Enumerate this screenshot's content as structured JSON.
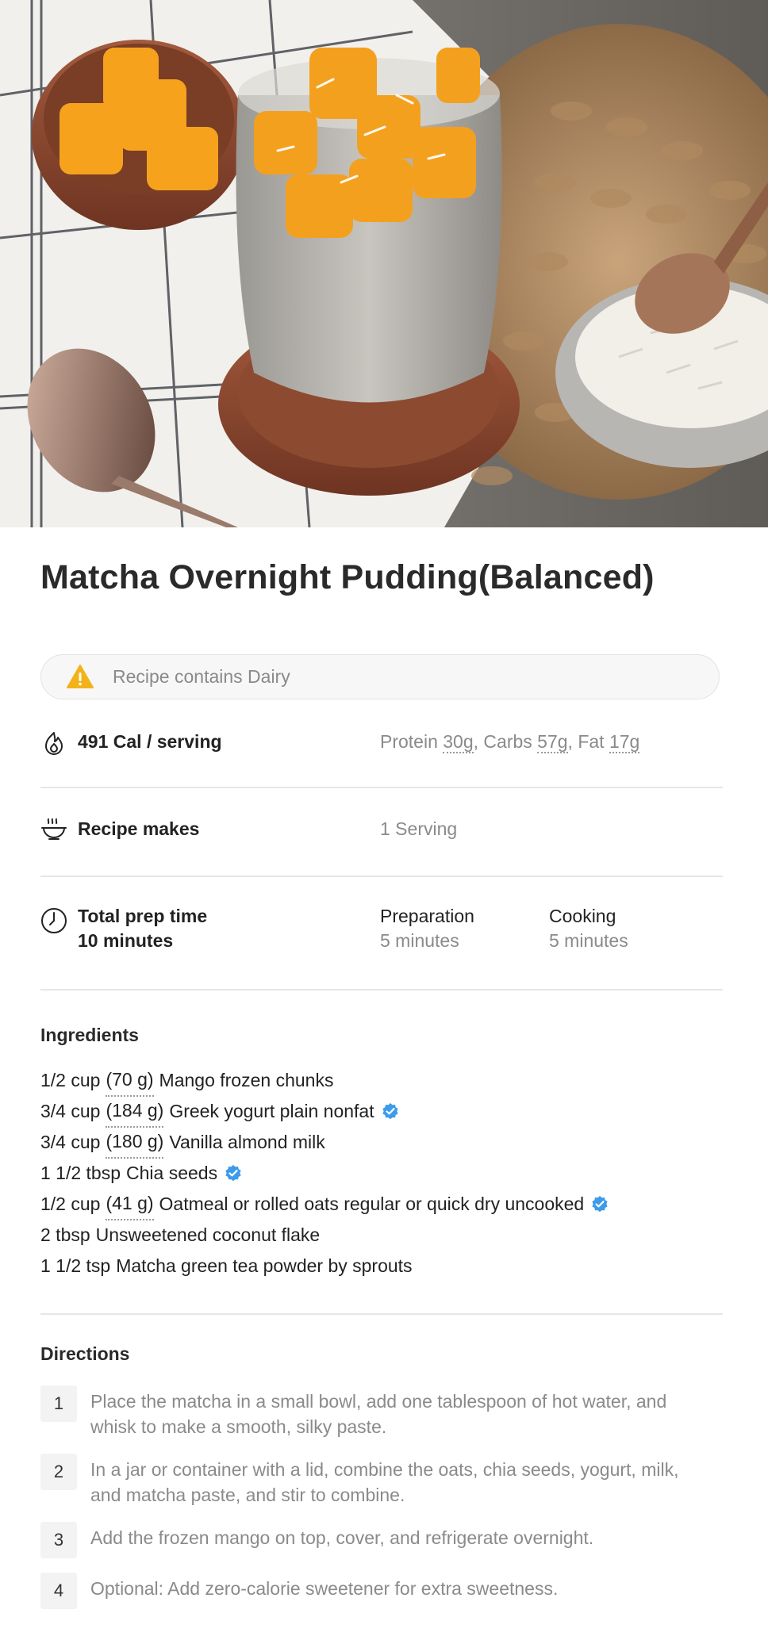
{
  "recipe": {
    "title": "Matcha Overnight Pudding(Balanced)",
    "allergy_notice": "Recipe contains Dairy",
    "nutrition": {
      "calories_label": "491 Cal / serving",
      "protein_label": "Protein ",
      "protein_value": "30g",
      "carbs_label": ", Carbs ",
      "carbs_value": "57g",
      "fat_label": ", Fat ",
      "fat_value": "17g"
    },
    "yield": {
      "label": "Recipe makes",
      "value": "1 Serving"
    },
    "time": {
      "total_label": "Total prep time",
      "total_value": "10 minutes",
      "prep_label": "Preparation",
      "prep_value": "5 minutes",
      "cook_label": "Cooking",
      "cook_value": "5 minutes"
    }
  },
  "ingredients": {
    "heading": "Ingredients",
    "items": [
      {
        "amount": "1/2 cup",
        "grams": "(70 g)",
        "name": "Mango frozen chunks",
        "verified": false
      },
      {
        "amount": "3/4 cup",
        "grams": "(184 g)",
        "name": "Greek yogurt plain nonfat",
        "verified": true
      },
      {
        "amount": "3/4 cup",
        "grams": "(180 g)",
        "name": "Vanilla almond milk",
        "verified": false
      },
      {
        "amount": "1 1/2 tbsp",
        "grams": "",
        "name": "Chia seeds",
        "verified": true
      },
      {
        "amount": "1/2 cup",
        "grams": "(41 g)",
        "name": "Oatmeal or rolled oats regular or quick dry uncooked",
        "verified": true
      },
      {
        "amount": "2 tbsp",
        "grams": "",
        "name": "Unsweetened coconut flake",
        "verified": false
      },
      {
        "amount": "1 1/2 tsp",
        "grams": "",
        "name": "Matcha green tea powder by sprouts",
        "verified": false
      }
    ]
  },
  "directions": {
    "heading": "Directions",
    "steps": [
      {
        "num": "1",
        "text": "Place the matcha in a small bowl, add one tablespoon of hot water, and whisk to make a smooth, silky paste."
      },
      {
        "num": "2",
        "text": "In a jar or container with a lid, combine the oats, chia seeds, yogurt, milk, and matcha paste, and stir to combine."
      },
      {
        "num": "3",
        "text": "Add the frozen mango on top, cover, and refrigerate overnight."
      },
      {
        "num": "4",
        "text": "Optional:  Add zero-calorie sweetener for extra sweetness."
      }
    ]
  },
  "icons": {
    "warning": "warning-triangle-icon",
    "calories": "flame-icon",
    "yield": "bowl-icon",
    "time": "clock-icon",
    "verified": "verified-badge-icon"
  },
  "colors": {
    "warning": "#f2b31a",
    "verified": "#3d9be9",
    "muted_text": "#8a8a8a",
    "divider": "#e6e6e6"
  }
}
